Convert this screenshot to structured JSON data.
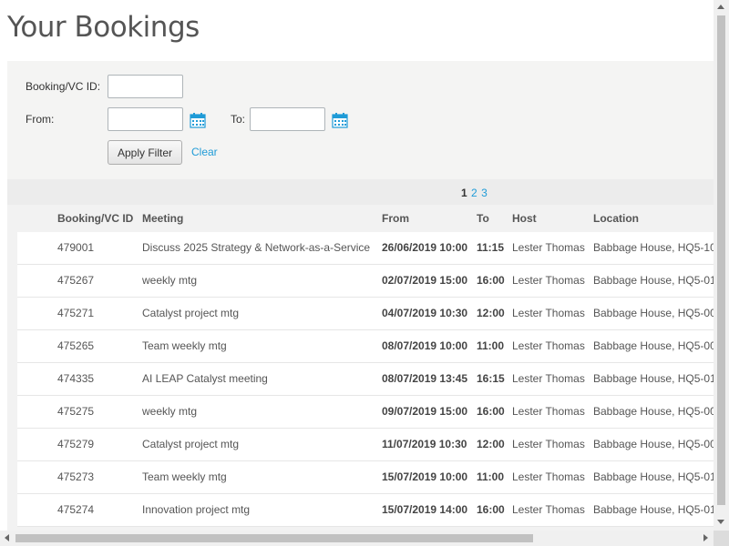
{
  "page": {
    "title": "Your Bookings"
  },
  "filter": {
    "booking_id_label": "Booking/VC ID:",
    "booking_id_value": "",
    "from_label": "From:",
    "from_value": "",
    "to_label": "To:",
    "to_value": "",
    "apply_label": "Apply Filter",
    "clear_label": "Clear",
    "calendar_icon": "calendar-icon"
  },
  "pagination": {
    "current": "1",
    "pages": [
      "2",
      "3"
    ]
  },
  "table": {
    "columns": {
      "id": "Booking/VC ID",
      "meeting": "Meeting",
      "from": "From",
      "to": "To",
      "host": "Host",
      "location": "Location"
    },
    "rows": [
      {
        "id": "479001",
        "meeting": "Discuss 2025 Strategy & Network-as-a-Service",
        "from": "26/06/2019 10:00",
        "to": "11:15",
        "host": "Lester Thomas",
        "location": "Babbage House, HQ5-10"
      },
      {
        "id": "475267",
        "meeting": "weekly mtg",
        "from": "02/07/2019 15:00",
        "to": "16:00",
        "host": "Lester Thomas",
        "location": "Babbage House, HQ5-01"
      },
      {
        "id": "475271",
        "meeting": "Catalyst project mtg",
        "from": "04/07/2019 10:30",
        "to": "12:00",
        "host": "Lester Thomas",
        "location": "Babbage House, HQ5-00"
      },
      {
        "id": "475265",
        "meeting": "Team weekly mtg",
        "from": "08/07/2019 10:00",
        "to": "11:00",
        "host": "Lester Thomas",
        "location": "Babbage House, HQ5-00"
      },
      {
        "id": "474335",
        "meeting": "AI LEAP Catalyst meeting",
        "from": "08/07/2019 13:45",
        "to": "16:15",
        "host": "Lester Thomas",
        "location": "Babbage House, HQ5-01"
      },
      {
        "id": "475275",
        "meeting": "weekly mtg",
        "from": "09/07/2019 15:00",
        "to": "16:00",
        "host": "Lester Thomas",
        "location": "Babbage House, HQ5-00"
      },
      {
        "id": "475279",
        "meeting": "Catalyst project mtg",
        "from": "11/07/2019 10:30",
        "to": "12:00",
        "host": "Lester Thomas",
        "location": "Babbage House, HQ5-00"
      },
      {
        "id": "475273",
        "meeting": "Team weekly mtg",
        "from": "15/07/2019 10:00",
        "to": "11:00",
        "host": "Lester Thomas",
        "location": "Babbage House, HQ5-01"
      },
      {
        "id": "475274",
        "meeting": "Innovation project mtg",
        "from": "15/07/2019 14:00",
        "to": "16:00",
        "host": "Lester Thomas",
        "location": "Babbage House, HQ5-01"
      }
    ]
  },
  "colors": {
    "link": "#1f9bd7",
    "panel_bg": "#f4f4f3",
    "pager_bg": "#ececec"
  }
}
